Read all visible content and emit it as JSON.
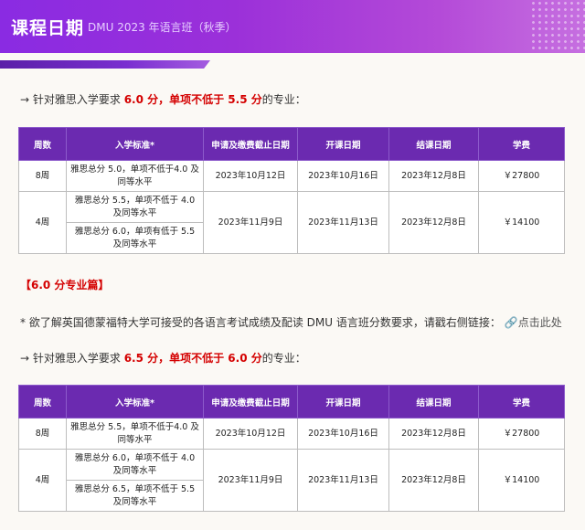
{
  "header": {
    "title": "课程日期",
    "subtitle": "DMU 2023 年语言班（秋季）"
  },
  "sections": [
    {
      "req_prefix": "→ 针对雅思入学要求 ",
      "req_score": "6.0 分，单项不低于 5.5 分",
      "req_suffix": "的专业："
    },
    {
      "req_prefix": "→ 针对雅思入学要求 ",
      "req_score": "6.5 分，单项不低于 6.0 分",
      "req_suffix": "的专业："
    }
  ],
  "table_headers": [
    "周数",
    "入学标准*",
    "申请及缴费截止日期",
    "开课日期",
    "结课日期",
    "学费"
  ],
  "table1": {
    "row1": {
      "weeks": "8周",
      "requirement": "雅思总分 5.0，单项不低于4.0 及同等水平",
      "deadline": "2023年10月12日",
      "start": "2023年10月16日",
      "end": "2023年12月8日",
      "fee": "￥27800"
    },
    "row2": {
      "weeks": "4周",
      "requirement_a": "雅思总分 5.5，单项不低于 4.0 及同等水平",
      "requirement_b": "雅思总分 6.0，单项有低于 5.5 及同等水平",
      "deadline": "2023年11月9日",
      "start": "2023年11月13日",
      "end": "2023年12月8日",
      "fee": "￥14100"
    }
  },
  "table2": {
    "row1": {
      "weeks": "8周",
      "requirement": "雅思总分 5.5，单项不低于4.0 及同等水平",
      "deadline": "2023年10月12日",
      "start": "2023年10月16日",
      "end": "2023年12月8日",
      "fee": "￥27800"
    },
    "row2": {
      "weeks": "4周",
      "requirement_a": "雅思总分 6.0，单项不低于 4.0 及同等水平",
      "requirement_b": "雅思总分 6.5，单项不低于 5.5 及同等水平",
      "deadline": "2023年11月9日",
      "start": "2023年11月13日",
      "end": "2023年12月8日",
      "fee": "￥14100"
    }
  },
  "section_title": "【6.0 分专业篇】",
  "note": {
    "text": "* 欲了解英国德蒙福特大学可接受的各语言考试成绩及配读 DMU 语言班分数要求，请戳右侧链接：",
    "link_icon": "link-icon",
    "link_label": "点击此处"
  },
  "colors": {
    "header_gradient_start": "#8a2be2",
    "table_header_bg": "#6b2ab0",
    "highlight_red": "#d40000"
  }
}
